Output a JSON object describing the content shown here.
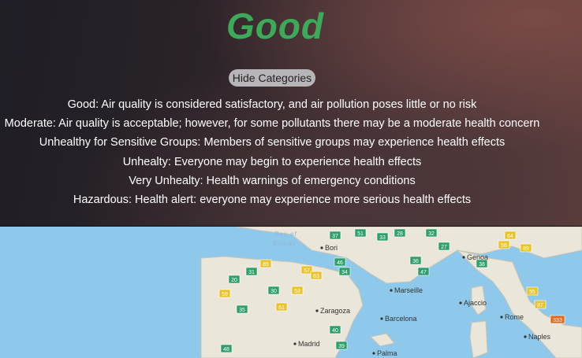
{
  "status": {
    "label": "Good",
    "color": "#3daa5a"
  },
  "toggle_label": "Hide Categories",
  "categories": [
    {
      "text": "Good: Air quality is considered satisfactory, and air pollution poses little or no risk"
    },
    {
      "text": "Moderate: Air quality is acceptable; however, for some pollutants there may be a moderate health concern"
    },
    {
      "text": "Unhealthy for Sensitive Groups: Members of sensitive groups may experience health effects"
    },
    {
      "text": "Unhealty: Everyone may begin to experience health effects"
    },
    {
      "text": "Very Unhealty: Health warnings of emergency conditions"
    },
    {
      "text": "Hazardous: Health alert: everyone may experience more serious health effects"
    }
  ],
  "map": {
    "sea_label": [
      "Bay of",
      "Biscay"
    ],
    "cities": [
      "Bori",
      "Marseille",
      "Genoa",
      "Zaragoza",
      "Barcelona",
      "Madrid",
      "Rome",
      "Naples",
      "Ajaccio",
      "Palma"
    ],
    "markers": [
      {
        "v": "37",
        "c": "#2e9e6b"
      },
      {
        "v": "51",
        "c": "#2e9e6b"
      },
      {
        "v": "33",
        "c": "#2e9e6b"
      },
      {
        "v": "28",
        "c": "#2e9e6b"
      },
      {
        "v": "32",
        "c": "#2e9e6b"
      },
      {
        "v": "64",
        "c": "#e8c32a"
      },
      {
        "v": "58",
        "c": "#e8c32a"
      },
      {
        "v": "89",
        "c": "#e8c32a"
      },
      {
        "v": "85",
        "c": "#e8c32a"
      },
      {
        "v": "57",
        "c": "#e8c32a"
      },
      {
        "v": "63",
        "c": "#e8c32a"
      },
      {
        "v": "53",
        "c": "#e8c32a"
      },
      {
        "v": "59",
        "c": "#e8c32a"
      },
      {
        "v": "61",
        "c": "#e8c32a"
      },
      {
        "v": "55",
        "c": "#e8c32a"
      },
      {
        "v": "333",
        "c": "#e06a1e"
      },
      {
        "v": "27",
        "c": "#2e9e6b"
      },
      {
        "v": "46",
        "c": "#2e9e6b"
      },
      {
        "v": "34",
        "c": "#2e9e6b"
      },
      {
        "v": "36",
        "c": "#2e9e6b"
      },
      {
        "v": "47",
        "c": "#2e9e6b"
      },
      {
        "v": "38",
        "c": "#2e9e6b"
      },
      {
        "v": "30",
        "c": "#2e9e6b"
      },
      {
        "v": "35",
        "c": "#2e9e6b"
      },
      {
        "v": "48",
        "c": "#2e9e6b"
      },
      {
        "v": "40",
        "c": "#2e9e6b"
      },
      {
        "v": "20",
        "c": "#2e9e6b"
      },
      {
        "v": "31",
        "c": "#2e9e6b"
      },
      {
        "v": "39",
        "c": "#2e9e6b"
      },
      {
        "v": "87",
        "c": "#e8c32a"
      }
    ]
  }
}
